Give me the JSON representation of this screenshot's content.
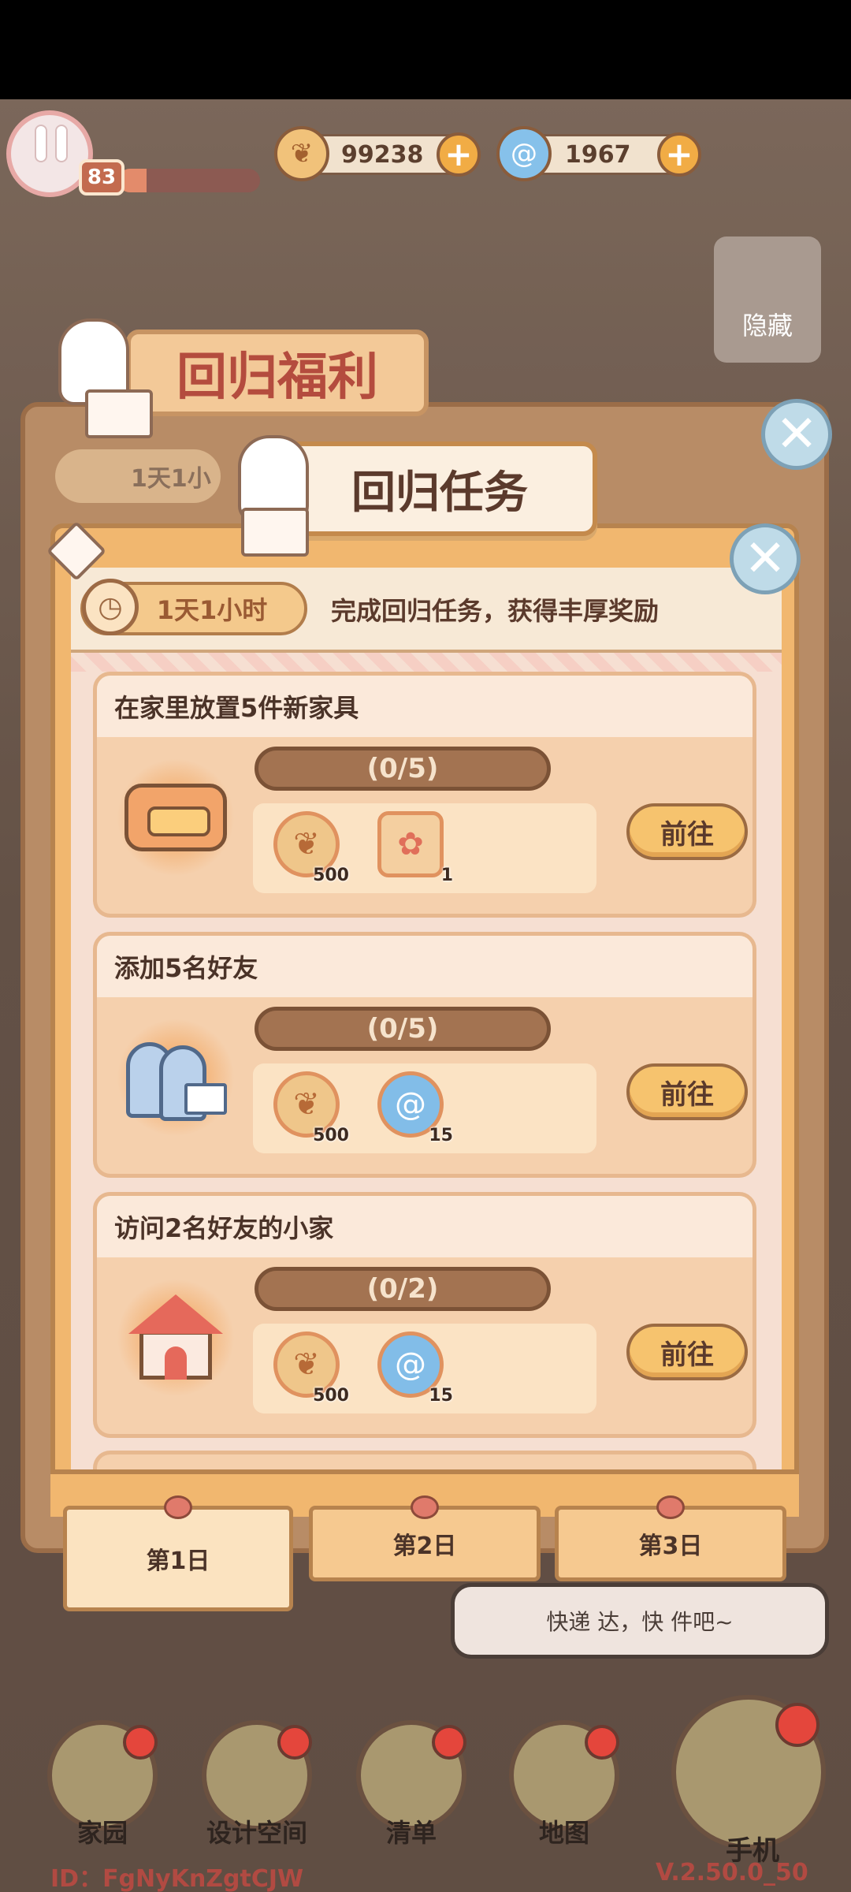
{
  "hud": {
    "level": "83",
    "xp_fraction": 0.2,
    "coins": "99238",
    "gems": "1967",
    "plus_symbol": "+"
  },
  "side": {
    "hide_label": "隐藏"
  },
  "back_panel": {
    "title": "回归福利",
    "timer": "1天1小"
  },
  "panel": {
    "title": "回归任务",
    "timer": "1天1小时",
    "subtitle": "完成回归任务，获得丰厚奖励",
    "close_symbol": "✕"
  },
  "tasks": [
    {
      "title": "在家里放置5件新家具",
      "progress": "(0/5)",
      "rewards": [
        {
          "icon": "coin-icon",
          "qty": "500"
        },
        {
          "icon": "paw-ticket-icon",
          "qty": "1"
        }
      ],
      "button": "前往"
    },
    {
      "title": "添加5名好友",
      "progress": "(0/5)",
      "rewards": [
        {
          "icon": "coin-icon",
          "qty": "500"
        },
        {
          "icon": "swirl-gem-icon",
          "qty": "15"
        }
      ],
      "button": "前往"
    },
    {
      "title": "访问2名好友的小家",
      "progress": "(0/2)",
      "rewards": [
        {
          "icon": "coin-icon",
          "qty": "500"
        },
        {
          "icon": "swirl-gem-icon",
          "qty": "15"
        }
      ],
      "button": "前往"
    }
  ],
  "days": [
    {
      "label": "第1日",
      "active": true
    },
    {
      "label": "第2日",
      "active": false
    },
    {
      "label": "第3日",
      "active": false
    }
  ],
  "bubble": {
    "text": "快递  达，快  件吧~"
  },
  "nav": [
    {
      "label": "家园",
      "icon": "home-icon"
    },
    {
      "label": "设计空间",
      "icon": "design-icon"
    },
    {
      "label": "清单",
      "icon": "list-icon"
    },
    {
      "label": "地图",
      "icon": "map-pin-icon"
    }
  ],
  "phone": {
    "label": "手机"
  },
  "footer": {
    "uid": "ID：FgNyKnZgtCJW",
    "version": "V.2.50.0_50"
  },
  "colors": {
    "panel": "#f1b76f",
    "card": "#f5d0ad",
    "button": "#f6c36e",
    "close": "#bfdbe8",
    "badge_red": "#e4463c"
  }
}
